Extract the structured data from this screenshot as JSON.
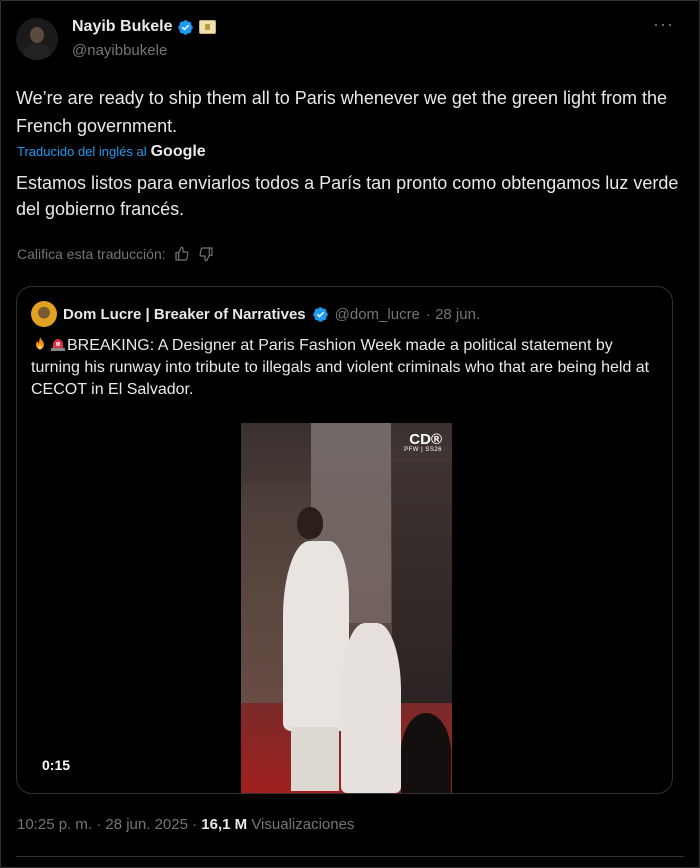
{
  "author": {
    "display_name": "Nayib Bukele",
    "handle": "@nayibbukele",
    "verified": true,
    "badge_color": "#1d9bf0"
  },
  "more_label": "···",
  "tweet": {
    "text": "We’re are ready to ship them all to Paris whenever we get the green light from the French government.",
    "translated_label": "Traducido del inglés al",
    "translator": "Google",
    "translation": "Estamos listos para enviarlos todos a París tan pronto como obtengamos luz verde del gobierno francés.",
    "rate_label": "Califica esta traducción:"
  },
  "quote": {
    "display_name": "Dom Lucre | Breaker of Narratives",
    "handle": "@dom_lucre",
    "date": "· 28 jun.",
    "text": "BREAKING: A Designer at Paris Fashion Week made a political statement by turning his runway into tribute to illegals and violent criminals who that are being held at CECOT in El Salvador.",
    "video": {
      "duration": "0:15",
      "logo": "CD®",
      "logo_sub": "PFW | SS26"
    }
  },
  "footer": {
    "time_date": "10:25 p. m. · 28 jun. 2025 · ",
    "views_count": "16,1 M",
    "views_label": "Visualizaciones"
  },
  "colors": {
    "background": "#000000",
    "text": "#e7e9ea",
    "muted": "#71767b",
    "accent": "#1d9bf0",
    "border": "#2f3336"
  }
}
